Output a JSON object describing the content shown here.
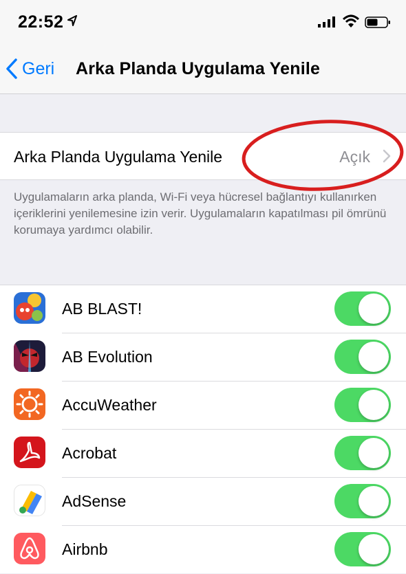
{
  "status_bar": {
    "time": "22:52"
  },
  "nav": {
    "back_label": "Geri",
    "title": "Arka Planda Uygulama Yenile"
  },
  "setting": {
    "label": "Arka Planda Uygulama Yenile",
    "value": "Açık"
  },
  "footer_note": "Uygulamaların arka planda, Wi-Fi veya hücresel bağlantıyı kullanırken içeriklerini yenilemesine izin verir. Uygulamaların kapatılması pil ömrünü korumaya yardımcı olabilir.",
  "apps": [
    {
      "name": "AB BLAST!",
      "icon": "ab-blast-icon",
      "enabled": true
    },
    {
      "name": "AB Evolution",
      "icon": "ab-evolution-icon",
      "enabled": true
    },
    {
      "name": "AccuWeather",
      "icon": "accuweather-icon",
      "enabled": true
    },
    {
      "name": "Acrobat",
      "icon": "acrobat-icon",
      "enabled": true
    },
    {
      "name": "AdSense",
      "icon": "adsense-icon",
      "enabled": true
    },
    {
      "name": "Airbnb",
      "icon": "airbnb-icon",
      "enabled": true
    }
  ],
  "colors": {
    "accent": "#007aff",
    "toggle_on": "#4cd964",
    "annotation": "#d81e1e"
  }
}
